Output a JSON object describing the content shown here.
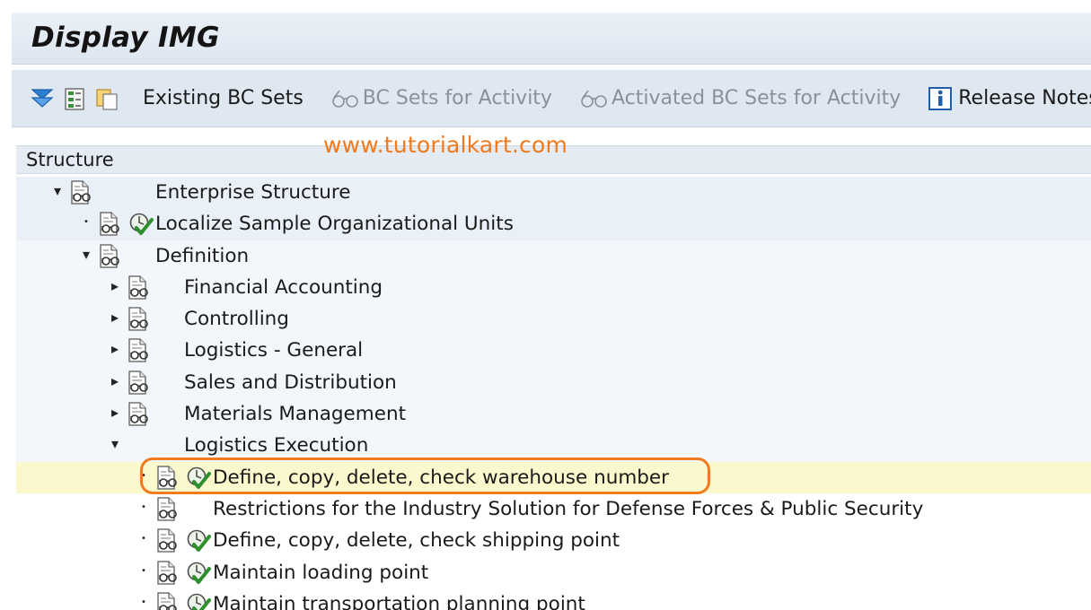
{
  "title": "Display IMG",
  "toolbar": {
    "existing_bc_sets": "Existing BC Sets",
    "bc_sets_for_activity": "BC Sets for Activity",
    "activated_bc_sets_for_activity": "Activated BC Sets for Activity",
    "release_notes": "Release Notes"
  },
  "watermark": "www.tutorialkart.com",
  "tree": {
    "header": "Structure",
    "items": [
      {
        "label": "Enterprise Structure",
        "level": 0,
        "expander": "expanded",
        "activity": false
      },
      {
        "label": "Localize Sample Organizational Units",
        "level": 1,
        "expander": "leaf",
        "activity": true
      },
      {
        "label": "Definition",
        "level": 1,
        "expander": "expanded",
        "activity": false
      },
      {
        "label": "Financial Accounting",
        "level": 2,
        "expander": "collapsed",
        "activity": false
      },
      {
        "label": "Controlling",
        "level": 2,
        "expander": "collapsed",
        "activity": false
      },
      {
        "label": "Logistics - General",
        "level": 2,
        "expander": "collapsed",
        "activity": false
      },
      {
        "label": "Sales and Distribution",
        "level": 2,
        "expander": "collapsed",
        "activity": false
      },
      {
        "label": "Materials Management",
        "level": 2,
        "expander": "collapsed",
        "activity": false
      },
      {
        "label": "Logistics Execution",
        "level": 2,
        "expander": "expanded",
        "activity": false,
        "no_doc_icon": true
      },
      {
        "label": "Define, copy, delete, check warehouse number",
        "level": 3,
        "expander": "leaf",
        "activity": true,
        "selected": true
      },
      {
        "label": "Restrictions for the Industry Solution for Defense Forces & Public Security",
        "level": 3,
        "expander": "leaf",
        "activity": false
      },
      {
        "label": "Define, copy, delete, check shipping point",
        "level": 3,
        "expander": "leaf",
        "activity": true
      },
      {
        "label": "Maintain loading point",
        "level": 3,
        "expander": "leaf",
        "activity": true
      },
      {
        "label": "Maintain transportation planning point",
        "level": 3,
        "expander": "leaf",
        "activity": true
      }
    ]
  },
  "colors": {
    "accent": "#f07a1e",
    "selected_row": "#fbf8cd"
  }
}
